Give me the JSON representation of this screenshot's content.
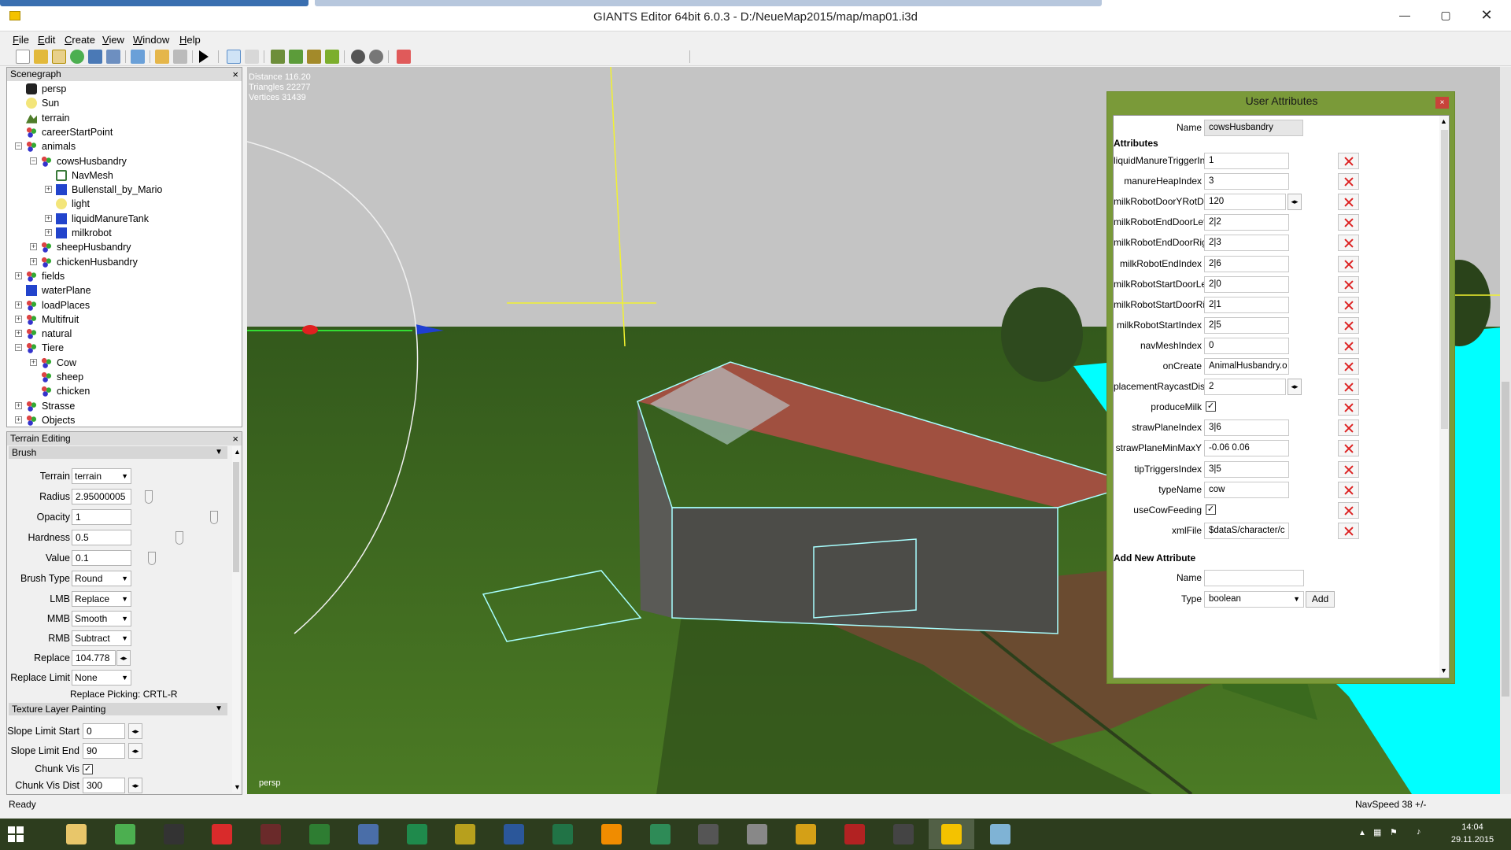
{
  "window": {
    "title": "GIANTS Editor 64bit 6.0.3 - D:/NeueMap2015/map/map01.i3d"
  },
  "menu": [
    {
      "pre": "",
      "u": "F",
      "post": "ile"
    },
    {
      "pre": "",
      "u": "E",
      "post": "dit"
    },
    {
      "pre": "",
      "u": "C",
      "post": "reate"
    },
    {
      "pre": "",
      "u": "V",
      "post": "iew"
    },
    {
      "pre": "",
      "u": "W",
      "post": "indow"
    },
    {
      "pre": "",
      "u": "H",
      "post": "elp"
    }
  ],
  "scenegraph": {
    "title": "Scenegraph",
    "close": "×",
    "items": [
      {
        "label": "persp",
        "icon": "camera-icon"
      },
      {
        "label": "Sun",
        "icon": "light-bulb-icon"
      },
      {
        "label": "terrain",
        "icon": "terrain-icon"
      },
      {
        "label": "careerStartPoint",
        "icon": "transform-group-icon"
      },
      {
        "label": "animals",
        "icon": "transform-group-icon"
      },
      {
        "label": "cowsHusbandry",
        "icon": "transform-group-icon"
      },
      {
        "label": "NavMesh",
        "icon": "navmesh-icon"
      },
      {
        "label": "Bullenstall_by_Mario",
        "icon": "shape-cube-icon"
      },
      {
        "label": "light",
        "icon": "light-bulb-icon"
      },
      {
        "label": "liquidManureTank",
        "icon": "shape-cube-icon"
      },
      {
        "label": "milkrobot",
        "icon": "shape-cube-icon"
      },
      {
        "label": "sheepHusbandry",
        "icon": "transform-group-icon"
      },
      {
        "label": "chickenHusbandry",
        "icon": "transform-group-icon"
      },
      {
        "label": "fields",
        "icon": "transform-group-icon"
      },
      {
        "label": "waterPlane",
        "icon": "shape-cube-icon"
      },
      {
        "label": "loadPlaces",
        "icon": "transform-group-icon"
      },
      {
        "label": "Multifruit",
        "icon": "transform-group-icon"
      },
      {
        "label": "natural",
        "icon": "transform-group-icon"
      },
      {
        "label": "Tiere",
        "icon": "transform-group-icon"
      },
      {
        "label": "Cow",
        "icon": "transform-group-icon"
      },
      {
        "label": "sheep",
        "icon": "transform-group-icon"
      },
      {
        "label": "chicken",
        "icon": "transform-group-icon"
      },
      {
        "label": "Strasse",
        "icon": "transform-group-icon"
      },
      {
        "label": "Objects",
        "icon": "transform-group-icon"
      }
    ]
  },
  "terrain_editing": {
    "title": "Terrain Editing",
    "close": "×",
    "brush_section": "Brush",
    "terrain_label": "Terrain",
    "terrain_value": "terrain",
    "radius_label": "Radius",
    "radius_value": "2.95000005",
    "opacity_label": "Opacity",
    "opacity_value": "1",
    "hardness_label": "Hardness",
    "hardness_value": "0.5",
    "value_label": "Value",
    "value_value": "0.1",
    "brush_type_label": "Brush Type",
    "brush_type_value": "Round",
    "lmb_label": "LMB",
    "lmb_value": "Replace",
    "mmb_label": "MMB",
    "mmb_value": "Smooth",
    "rmb_label": "RMB",
    "rmb_value": "Subtract",
    "replace_label": "Replace",
    "replace_value": "104.778",
    "replace_limit_label": "Replace Limit",
    "replace_limit_value": "None",
    "replace_picking": "Replace Picking: CRTL-R",
    "texture_section": "Texture Layer Painting",
    "slope_start_label": "Slope Limit Start",
    "slope_start_value": "0",
    "slope_end_label": "Slope Limit End",
    "slope_end_value": "90",
    "chunk_vis_label": "Chunk Vis",
    "chunk_vis_checked": true,
    "chunk_vis_dist_label": "Chunk Vis Dist",
    "chunk_vis_dist_value": "300"
  },
  "viewport": {
    "distance": "Distance 116.20",
    "triangles": "Triangles 22277",
    "vertices": "Vertices 31439",
    "camera": "persp"
  },
  "user_attributes": {
    "title": "User Attributes",
    "close": "×",
    "name_label": "Name",
    "name_value": "cowsHusbandry",
    "attributes_heading": "Attributes",
    "attributes": [
      {
        "label": "liquidManureTriggerIndex",
        "value": "1",
        "spin": false
      },
      {
        "label": "manureHeapIndex",
        "value": "3",
        "spin": false
      },
      {
        "label": "milkRobotDoorYRotDelta",
        "value": "120",
        "spin": true
      },
      {
        "label": "milkRobotEndDoorLeft",
        "value": "2|2",
        "spin": false
      },
      {
        "label": "milkRobotEndDoorRight",
        "value": "2|3",
        "spin": false
      },
      {
        "label": "milkRobotEndIndex",
        "value": "2|6",
        "spin": false
      },
      {
        "label": "milkRobotStartDoorLeft",
        "value": "2|0",
        "spin": false
      },
      {
        "label": "milkRobotStartDoorRight",
        "value": "2|1",
        "spin": false
      },
      {
        "label": "milkRobotStartIndex",
        "value": "2|5",
        "spin": false
      },
      {
        "label": "navMeshIndex",
        "value": "0",
        "spin": false
      },
      {
        "label": "onCreate",
        "value": "AnimalHusbandry.o",
        "spin": false
      },
      {
        "label": "placementRaycastDistance",
        "value": "2",
        "spin": true
      },
      {
        "label": "produceMilk",
        "value": "",
        "checkbox": true
      },
      {
        "label": "strawPlaneIndex",
        "value": "3|6",
        "spin": false
      },
      {
        "label": "strawPlaneMinMaxY",
        "value": "-0.06 0.06",
        "spin": false
      },
      {
        "label": "tipTriggersIndex",
        "value": "3|5",
        "spin": false
      },
      {
        "label": "typeName",
        "value": "cow",
        "spin": false
      },
      {
        "label": "useCowFeeding",
        "value": "",
        "checkbox": true
      },
      {
        "label": "xmlFile",
        "value": "$dataS/character/c",
        "spin": false
      }
    ],
    "add_heading": "Add New Attribute",
    "add_name_label": "Name",
    "add_name_value": "",
    "add_type_label": "Type",
    "add_type_value": "boolean",
    "add_button": "Add"
  },
  "status": {
    "left": "Ready",
    "right": "NavSpeed 38 +/-"
  },
  "taskbar": {
    "time": "14:04",
    "date": "29.11.2015",
    "apps": [
      {
        "name": "file-explorer-icon",
        "color": "#e8c66a"
      },
      {
        "name": "chrome-icon",
        "color": "#4caf50"
      },
      {
        "name": "hp-icon",
        "color": "#333333"
      },
      {
        "name": "kaspersky-icon",
        "color": "#d92b2b"
      },
      {
        "name": "flag-app-icon",
        "color": "#6a2a2a"
      },
      {
        "name": "green-arrow-app-icon",
        "color": "#2e7d32"
      },
      {
        "name": "editor-app-icon",
        "color": "#4a6ea8"
      },
      {
        "name": "green-card-app-icon",
        "color": "#1f8a4c"
      },
      {
        "name": "yellow-orb-app-icon",
        "color": "#b7a01d"
      },
      {
        "name": "word-icon",
        "color": "#2b579a"
      },
      {
        "name": "excel-icon",
        "color": "#217346"
      },
      {
        "name": "vlc-icon",
        "color": "#f08c00"
      },
      {
        "name": "store-icon",
        "color": "#2e8b57"
      },
      {
        "name": "car-game-icon",
        "color": "#555555"
      },
      {
        "name": "chart-app-icon",
        "color": "#888888"
      },
      {
        "name": "paint-icon",
        "color": "#d4a017"
      },
      {
        "name": "red-circle-app-icon",
        "color": "#b22222"
      },
      {
        "name": "tractor-game-icon",
        "color": "#444444"
      },
      {
        "name": "giants-editor-icon",
        "color": "#f4c200"
      },
      {
        "name": "notes-icon",
        "color": "#7fb3d5"
      }
    ]
  },
  "colors": {
    "ua_frame": "#7a9a39",
    "grass": "#3f6a1e",
    "water": "#00ffff",
    "sky": "#c4c4c4",
    "taskbar": "#2d3d1e"
  }
}
